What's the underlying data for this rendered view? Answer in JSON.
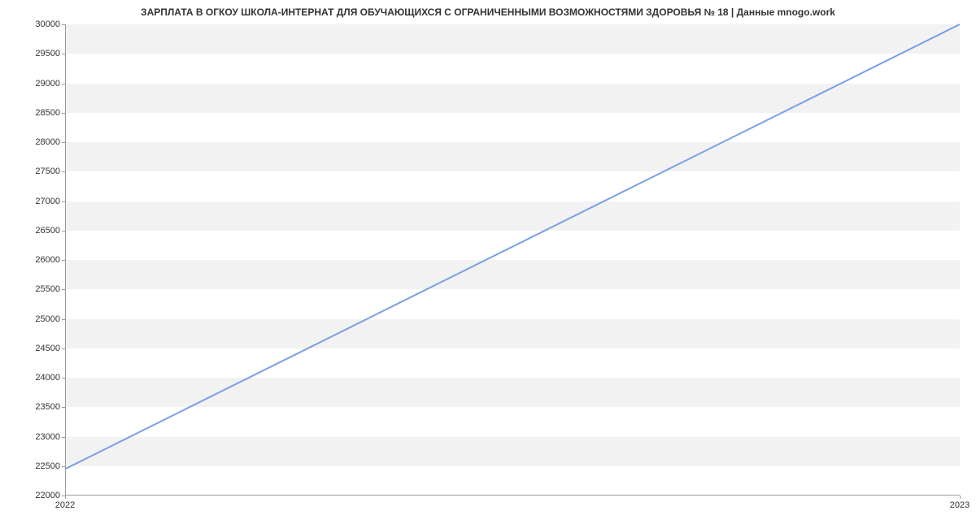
{
  "chart_data": {
    "type": "line",
    "title": "ЗАРПЛАТА В ОГКОУ ШКОЛА-ИНТЕРНАТ ДЛЯ ОБУЧАЮЩИХСЯ С ОГРАНИЧЕННЫМИ ВОЗМОЖНОСТЯМИ ЗДОРОВЬЯ № 18 | Данные mnogo.work",
    "x": [
      2022,
      2023
    ],
    "values": [
      22450,
      30000
    ],
    "xlabel": "",
    "ylabel": "",
    "ylim": [
      22000,
      30000
    ],
    "xlim": [
      2022,
      2023
    ],
    "y_ticks": [
      22000,
      22500,
      23000,
      23500,
      24000,
      24500,
      25000,
      25500,
      26000,
      26500,
      27000,
      27500,
      28000,
      28500,
      29000,
      29500,
      30000
    ],
    "x_ticks": [
      2022,
      2023
    ],
    "line_color": "#7a9fe6"
  }
}
